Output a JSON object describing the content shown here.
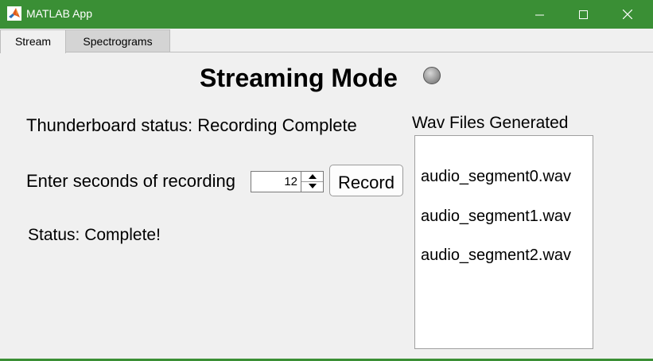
{
  "window": {
    "title": "MATLAB App",
    "accent_color": "#3a8f35",
    "controls": [
      "minimize-icon",
      "maximize-icon",
      "close-icon"
    ]
  },
  "tabs": [
    {
      "label": "Stream",
      "selected": true
    },
    {
      "label": "Spectrograms",
      "selected": false
    }
  ],
  "main": {
    "heading": "Streaming Mode",
    "lamp_state": "off",
    "thunderboard_status": "Thunderboard status: Recording Complete",
    "seconds_label": "Enter seconds of recording",
    "seconds_value": "12",
    "record_label": "Record",
    "status_text": "Status: Complete!"
  },
  "files": {
    "title": "Wav Files Generated",
    "items": [
      "audio_segment0.wav",
      "audio_segment1.wav",
      "audio_segment2.wav"
    ]
  }
}
